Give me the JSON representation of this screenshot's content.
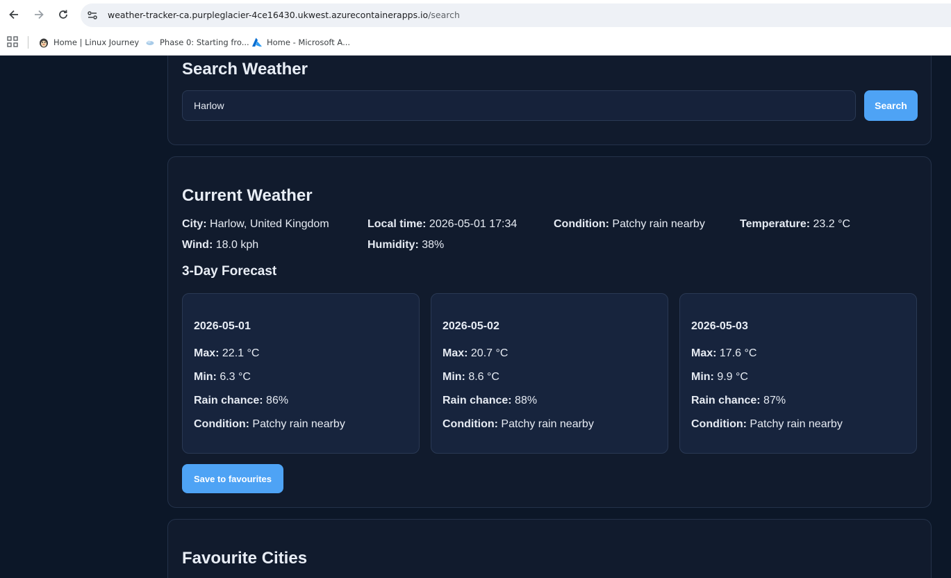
{
  "browser": {
    "url_host": "weather-tracker-ca.purpleglacier-4ce16430.ukwest.azurecontainerapps.io",
    "url_path": "/search",
    "bookmarks": [
      {
        "label": "Home | Linux Journey",
        "icon": "penguin-icon"
      },
      {
        "label": "Phase 0: Starting fro...",
        "icon": "cloud-icon"
      },
      {
        "label": "Home - Microsoft A...",
        "icon": "azure-icon"
      }
    ]
  },
  "search": {
    "title": "Search Weather",
    "input_value": "Harlow",
    "button_label": "Search"
  },
  "current": {
    "title": "Current Weather",
    "city_label": "City:",
    "city_value": "Harlow, United Kingdom",
    "local_time_label": "Local time:",
    "local_time_value": "2026-05-01 17:34",
    "condition_label": "Condition:",
    "condition_value": "Patchy rain nearby",
    "temperature_label": "Temperature:",
    "temperature_value": "23.2 °C",
    "wind_label": "Wind:",
    "wind_value": "18.0 kph",
    "humidity_label": "Humidity:",
    "humidity_value": "38%"
  },
  "forecast": {
    "title": "3-Day Forecast",
    "max_label": "Max:",
    "min_label": "Min:",
    "rain_label": "Rain chance:",
    "condition_label": "Condition:",
    "days": [
      {
        "date": "2026-05-01",
        "max": "22.1 °C",
        "min": "6.3 °C",
        "rain": "86%",
        "condition": "Patchy rain nearby"
      },
      {
        "date": "2026-05-02",
        "max": "20.7 °C",
        "min": "8.6 °C",
        "rain": "88%",
        "condition": "Patchy rain nearby"
      },
      {
        "date": "2026-05-03",
        "max": "17.6 °C",
        "min": "9.9 °C",
        "rain": "87%",
        "condition": "Patchy rain nearby"
      }
    ]
  },
  "save_button_label": "Save to favourites",
  "favourites": {
    "title": "Favourite Cities"
  },
  "colors": {
    "accent": "#4ea3f5",
    "page_background": "#0c1728",
    "card_background": "#111b2d"
  }
}
